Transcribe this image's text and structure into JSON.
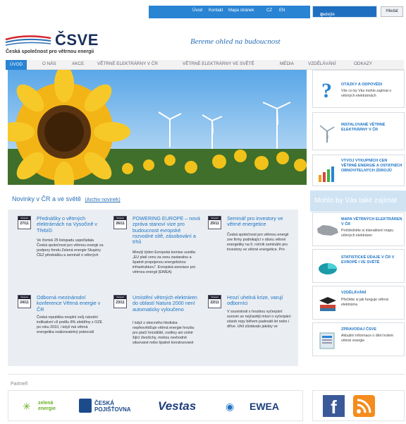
{
  "top_links": [
    "Úvod",
    "Kontakt",
    "Mapa stránek",
    "CZ",
    "EN"
  ],
  "search": {
    "placeholder": "zadejte hledaný výraz",
    "button": "Hledat"
  },
  "brand": {
    "name": "ČSVE",
    "subtitle": "Česká společnost pro větrnou energii",
    "motto": "Bereme ohled na budoucnost"
  },
  "nav": [
    "ÚVOD",
    "O NÁS",
    "AKCE",
    "VĚTRNÉ ELEKTRÁRNY V ČR",
    "VĚTRNÉ ELEKTRÁRNY VE SVĚTĚ",
    "MÉDIA",
    "VZDĚLÁVÁNÍ",
    "ODKAZY"
  ],
  "side_top": [
    {
      "title": "OTÁZKY A ODPOVĚDI",
      "desc": "Vše co by Vás mohlo zajímat o větrných elektrárnách",
      "icon": "question-icon"
    },
    {
      "title": "INSTALOVANÉ VĚTRNÉ ELEKTRÁRNY V ČR",
      "desc": "",
      "icon": "turbine-icon"
    },
    {
      "title": "VÝVOJ VÝKUPNÍCH CEN VĚTRNÉ ENERGIE A OSTATNÍCH OBNOVITELNÝCH ZDROJŮ",
      "desc": "",
      "icon": "bar-chart-icon"
    }
  ],
  "side_heading": "Mohlo by Vás také zajímat",
  "side_more": [
    {
      "title": "MAPA VĚTRNÝCH ELEKTRÁREN V ČR",
      "desc": "Prohlédněte si interaktivní mapu větrných elektráren",
      "icon": "map-icon"
    },
    {
      "title": "STATISTICKÉ ÚDAJE V ČR V EVROPĚ I VE SVĚTĚ",
      "desc": "",
      "icon": "pie-chart-icon"
    },
    {
      "title": "VZDĚLÁVÁNÍ",
      "desc": "Přečtěte si jak funguje větrná elektrárna",
      "icon": "graduation-icon"
    },
    {
      "title": "ZPRAVODAJ ČSVE",
      "desc": "Aktuální informace o dění kolem větrné energie",
      "icon": "newsletter-icon"
    }
  ],
  "news": {
    "heading": "Novinky v ČR a ve světě",
    "archive": "(Archiv novinek)",
    "items": [
      {
        "month": "listopad",
        "day": "27/11",
        "title": "Přednášky o větrných elektrárnách na Vysočině v Třebíči",
        "text": "Ve čtvrtek 25 listopadu uspořádala Česká společnost pro větrnou energii za podpory fondu Zelená energie Skupiny ČEZ přednášku a seminář o větrných"
      },
      {
        "month": "listopad",
        "day": "26/11",
        "title": "POWERING EUROPE – nová zpráva stanoví vize pro budoucnost evropské rozvodné sítě, zásobování a trhů",
        "text": "Minulý týden Evropská komise uvedla: „EU platí cenu za svou zastaralou a špatně propojenou energetickou infrastrukturu\". Evropská asociace pro větrnou energii (EWEA)"
      },
      {
        "month": "listopad",
        "day": "25/11",
        "title": "Seminář pro investory ve větrné energetice",
        "text": "Česká společnost pro větrnou energii zve firmy podnikající v oboru větrné energetiky na II. ročník semináře pro investory ve větrné energetice. Pro"
      },
      {
        "month": "listopad",
        "day": "24/11",
        "title": "Odborná mezinárodní konference Větrná energie v ČR",
        "text": "Česká republika nesplní svůj národní indikativní cíl podílu 8% elektřiny z OZE po roku 2010, i když má větrná energetika realizovatelný potenciál"
      },
      {
        "month": "listopad",
        "day": "23/11",
        "title": "Umístění větrných elektráren do oblastí Natura 2000 není automaticky vyloučeno",
        "text": "I když z obecného hlediska nepřesvědčuje větrná energie hrozbu pro ptačí hnízdiště, rostliny ani volně žijící živočichy, mohou nevhodně situované nebo špatně konstruované"
      },
      {
        "month": "listopad",
        "day": "22/11",
        "title": "Hrozí uhelná krize, varují odborníci",
        "text": "V souvislosti s hrozbou vyčerpání surovin se nejčastěji mluví o vyčerpání zásob ropy během padesáti let nebo i dříve. Uhlí zůstávalo jakoby ve"
      }
    ]
  },
  "partners": {
    "label": "Partneři",
    "logos": [
      "zelená energie",
      "ČESKÁ POJIŠŤOVNA",
      "Vestas",
      "EWEA"
    ]
  },
  "social": [
    "facebook-icon",
    "rss-icon"
  ],
  "colors": {
    "accent": "#2a84d4",
    "brand": "#1a2f5a",
    "link": "#1c73c4"
  }
}
